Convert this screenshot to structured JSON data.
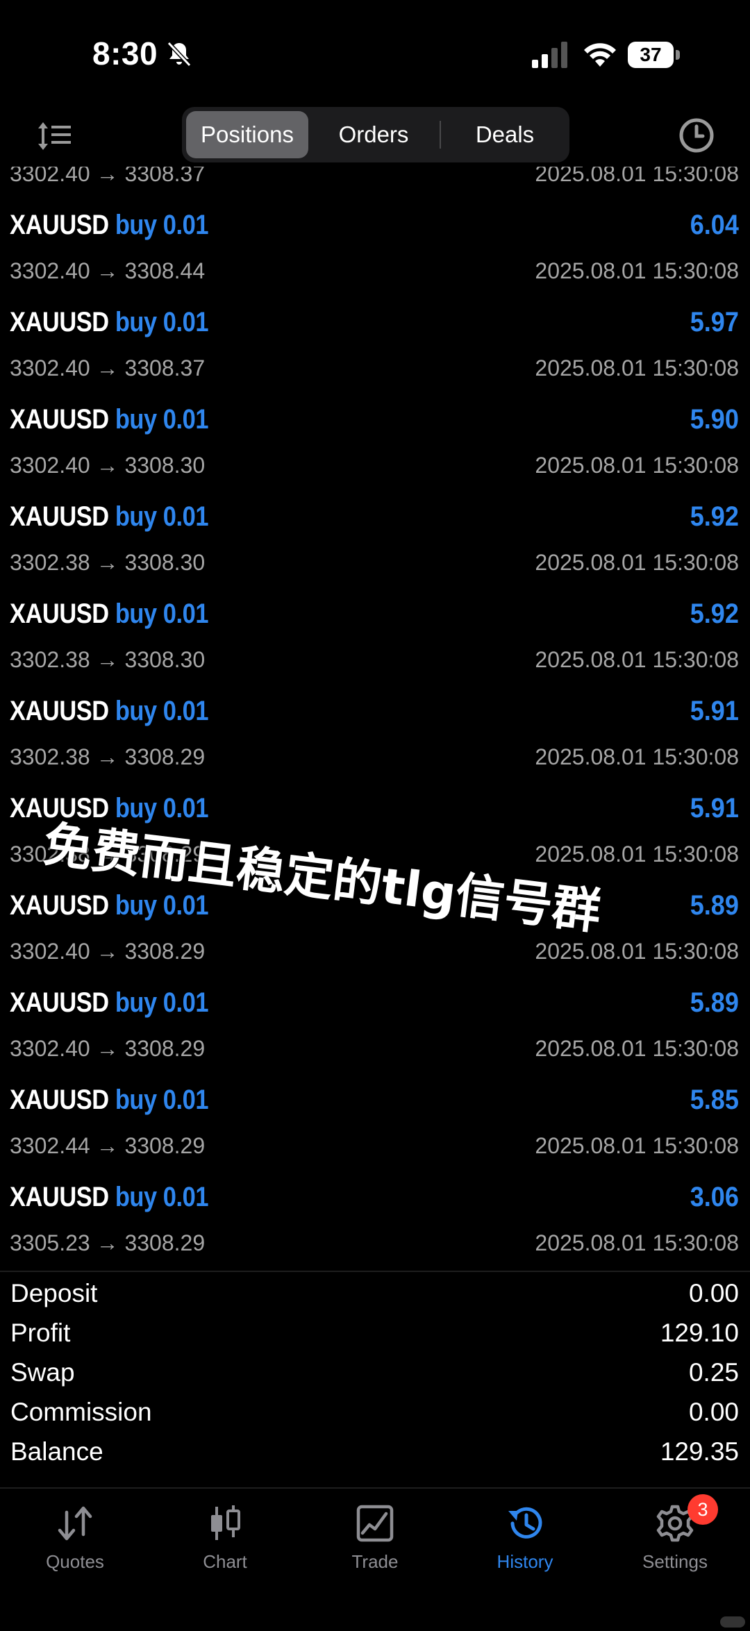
{
  "status": {
    "time": "8:30",
    "battery": "37"
  },
  "segments": [
    {
      "label": "Positions",
      "active": true
    },
    {
      "label": "Orders",
      "active": false
    },
    {
      "label": "Deals",
      "active": false
    }
  ],
  "list": {
    "partial_top": {
      "prices": "3302.40 → 3308.37",
      "time": "2025.08.01 15:30:08"
    },
    "rows": [
      {
        "symbol": "XAUUSD",
        "side": "buy 0.01",
        "profit": "6.04",
        "prices": "3302.40 → 3308.44",
        "time": "2025.08.01 15:30:08"
      },
      {
        "symbol": "XAUUSD",
        "side": "buy 0.01",
        "profit": "5.97",
        "prices": "3302.40 → 3308.37",
        "time": "2025.08.01 15:30:08"
      },
      {
        "symbol": "XAUUSD",
        "side": "buy 0.01",
        "profit": "5.90",
        "prices": "3302.40 → 3308.30",
        "time": "2025.08.01 15:30:08"
      },
      {
        "symbol": "XAUUSD",
        "side": "buy 0.01",
        "profit": "5.92",
        "prices": "3302.38 → 3308.30",
        "time": "2025.08.01 15:30:08"
      },
      {
        "symbol": "XAUUSD",
        "side": "buy 0.01",
        "profit": "5.92",
        "prices": "3302.38 → 3308.30",
        "time": "2025.08.01 15:30:08"
      },
      {
        "symbol": "XAUUSD",
        "side": "buy 0.01",
        "profit": "5.91",
        "prices": "3302.38 → 3308.29",
        "time": "2025.08.01 15:30:08"
      },
      {
        "symbol": "XAUUSD",
        "side": "buy 0.01",
        "profit": "5.91",
        "prices": "3302.38 → 3308.29",
        "time": "2025.08.01 15:30:08"
      },
      {
        "symbol": "XAUUSD",
        "side": "buy 0.01",
        "profit": "5.89",
        "prices": "3302.40 → 3308.29",
        "time": "2025.08.01 15:30:08"
      },
      {
        "symbol": "XAUUSD",
        "side": "buy 0.01",
        "profit": "5.89",
        "prices": "3302.40 → 3308.29",
        "time": "2025.08.01 15:30:08"
      },
      {
        "symbol": "XAUUSD",
        "side": "buy 0.01",
        "profit": "5.85",
        "prices": "3302.44 → 3308.29",
        "time": "2025.08.01 15:30:08"
      },
      {
        "symbol": "XAUUSD",
        "side": "buy 0.01",
        "profit": "3.06",
        "prices": "3305.23 → 3308.29",
        "time": "2025.08.01 15:30:08"
      }
    ]
  },
  "summary": [
    {
      "label": "Deposit",
      "value": "0.00"
    },
    {
      "label": "Profit",
      "value": "129.10"
    },
    {
      "label": "Swap",
      "value": "0.25"
    },
    {
      "label": "Commission",
      "value": "0.00"
    },
    {
      "label": "Balance",
      "value": "129.35"
    }
  ],
  "tabs": [
    {
      "label": "Quotes",
      "icon": "quotes-arrows-icon",
      "active": false
    },
    {
      "label": "Chart",
      "icon": "candlestick-icon",
      "active": false
    },
    {
      "label": "Trade",
      "icon": "trade-chart-icon",
      "active": false
    },
    {
      "label": "History",
      "icon": "history-clock-icon",
      "active": true
    },
    {
      "label": "Settings",
      "icon": "gear-icon",
      "active": false,
      "badge": "3"
    }
  ],
  "watermark": "免费而且稳定的tlg信号群",
  "colors": {
    "accent": "#2f86ee",
    "secondary_text": "#a6a6a6",
    "badge": "#ff3b30"
  }
}
